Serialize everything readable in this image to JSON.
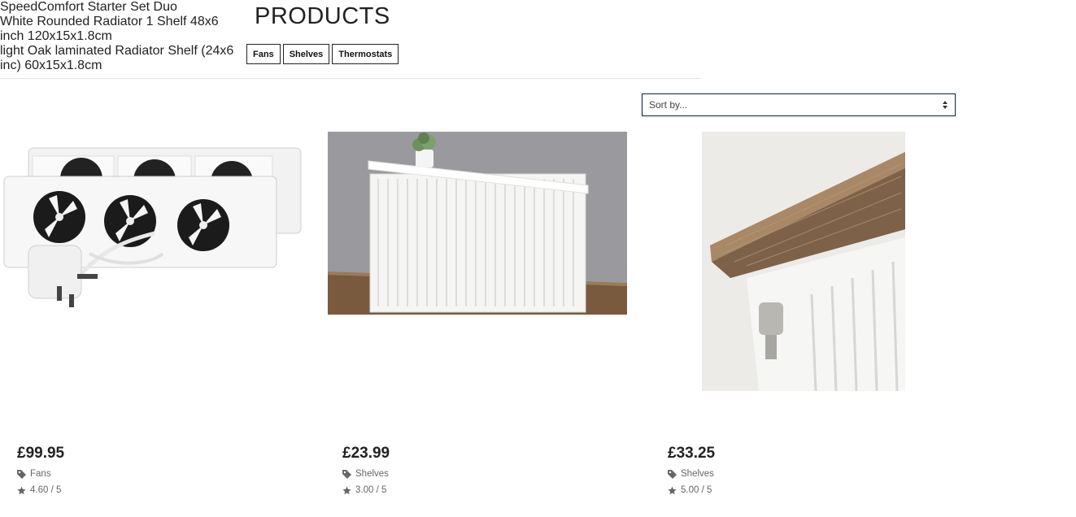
{
  "header": {
    "title": "PRODUCTS",
    "filters": [
      {
        "label": "Fans"
      },
      {
        "label": "Shelves"
      },
      {
        "label": "Thermostats"
      }
    ]
  },
  "sort": {
    "label": "Sort by..."
  },
  "products": [
    {
      "name": "SpeedComfort Starter Set Duo",
      "price": "£99.95",
      "category": "Fans",
      "rating": "4.60 / 5",
      "image_icon": "radiator-fan-product-image"
    },
    {
      "name": "White Rounded Radiator 1 Shelf 48x6 inch 120x15x1.8cm",
      "price": "£23.99",
      "category": "Shelves",
      "rating": "3.00 / 5",
      "image_icon": "white-radiator-shelf-product-image"
    },
    {
      "name": "light Oak laminated Radiator Shelf (24x6 inc) 60x15x1.8cm",
      "price": "£33.25",
      "category": "Shelves",
      "rating": "5.00 / 5",
      "image_icon": "oak-radiator-shelf-product-image"
    }
  ]
}
